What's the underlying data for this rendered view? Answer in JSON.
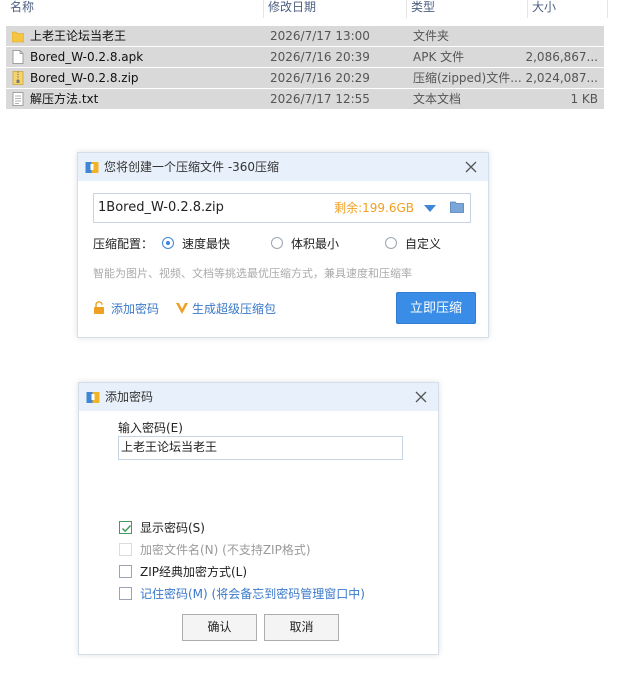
{
  "explorer": {
    "columns": {
      "name": "名称",
      "modified": "修改日期",
      "type": "类型",
      "size": "大小"
    },
    "rows": [
      {
        "icon": "folder-icon",
        "name": "上老王论坛当老王",
        "modified": "2026/7/17 13:00",
        "type": "文件夹",
        "size": ""
      },
      {
        "icon": "apk-file-icon",
        "name": "Bored_W-0.2.8.apk",
        "modified": "2026/7/16 20:39",
        "type": "APK 文件",
        "size": "2,086,867..."
      },
      {
        "icon": "zip-file-icon",
        "name": "Bored_W-0.2.8.zip",
        "modified": "2026/7/16 20:29",
        "type": "压缩(zipped)文件...",
        "size": "2,024,087..."
      },
      {
        "icon": "txt-file-icon",
        "name": "解压方法.txt",
        "modified": "2026/7/17 12:55",
        "type": "文本文档",
        "size": "1 KB"
      }
    ]
  },
  "compress_dialog": {
    "title": "您将创建一个压缩文件 -360压缩",
    "filename": "1Bored_W-0.2.8.zip",
    "free_space": "剩余:199.6GB",
    "config_label": "压缩配置：",
    "options": [
      {
        "label": "速度最快",
        "selected": true
      },
      {
        "label": "体积最小",
        "selected": false
      },
      {
        "label": "自定义",
        "selected": false
      }
    ],
    "hint": "智能为图片、视频、文档等挑选最优压缩方式，兼具速度和压缩率",
    "add_password": "添加密码",
    "super_package": "生成超级压缩包",
    "compress_now": "立即压缩"
  },
  "password_dialog": {
    "title": "添加密码",
    "input_label": "输入密码(E)",
    "password_value": "上老王论坛当老王",
    "checks": [
      {
        "label": "显示密码(S)",
        "checked": true,
        "disabled": false
      },
      {
        "label": "加密文件名(N) (不支持ZIP格式)",
        "checked": false,
        "disabled": true
      },
      {
        "label": "ZIP经典加密方式(L)",
        "checked": false,
        "disabled": false
      },
      {
        "label": "记住密码(M) (将会备忘到密码管理窗口中)",
        "checked": false,
        "disabled": false
      }
    ],
    "ok": "确认",
    "cancel": "取消"
  },
  "colors": {
    "accent": "#3a8de6",
    "title_bar": "#e8f1fb",
    "selection": "#d9d9d9",
    "free_space": "#f0a020",
    "link": "#3a79c9"
  }
}
